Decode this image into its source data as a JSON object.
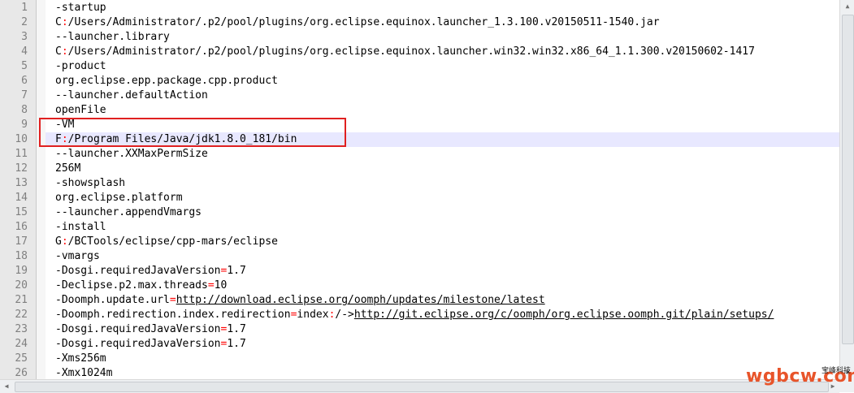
{
  "editor": {
    "highlighted_line": 10,
    "lines": [
      {
        "n": "1",
        "parts": [
          {
            "t": "-startup"
          }
        ]
      },
      {
        "n": "2",
        "parts": [
          {
            "t": "C"
          },
          {
            "t": ":",
            "op": true
          },
          {
            "t": "/Users/Administrator/.p2/pool/plugins/org.eclipse.equinox.launcher_1.3.100.v20150511-1540.jar"
          }
        ]
      },
      {
        "n": "3",
        "parts": [
          {
            "t": "--launcher.library"
          }
        ]
      },
      {
        "n": "4",
        "parts": [
          {
            "t": "C"
          },
          {
            "t": ":",
            "op": true
          },
          {
            "t": "/Users/Administrator/.p2/pool/plugins/org.eclipse.equinox.launcher.win32.win32.x86_64_1.1.300.v20150602-1417"
          }
        ]
      },
      {
        "n": "5",
        "parts": [
          {
            "t": "-product"
          }
        ]
      },
      {
        "n": "6",
        "parts": [
          {
            "t": "org.eclipse.epp.package.cpp.product"
          }
        ]
      },
      {
        "n": "7",
        "parts": [
          {
            "t": "--launcher.defaultAction"
          }
        ]
      },
      {
        "n": "8",
        "parts": [
          {
            "t": "openFile"
          }
        ]
      },
      {
        "n": "9",
        "parts": [
          {
            "t": "-VM"
          }
        ]
      },
      {
        "n": "10",
        "parts": [
          {
            "t": "F"
          },
          {
            "t": ":",
            "op": true
          },
          {
            "t": "/Program Files/Java/jdk1.8.0_181/bin"
          }
        ]
      },
      {
        "n": "11",
        "parts": [
          {
            "t": "--launcher.XXMaxPermSize"
          }
        ]
      },
      {
        "n": "12",
        "parts": [
          {
            "t": "256M"
          }
        ]
      },
      {
        "n": "13",
        "parts": [
          {
            "t": "-showsplash"
          }
        ]
      },
      {
        "n": "14",
        "parts": [
          {
            "t": "org.eclipse.platform"
          }
        ]
      },
      {
        "n": "15",
        "parts": [
          {
            "t": "--launcher.appendVmargs"
          }
        ]
      },
      {
        "n": "16",
        "parts": [
          {
            "t": "-install"
          }
        ]
      },
      {
        "n": "17",
        "parts": [
          {
            "t": "G"
          },
          {
            "t": ":",
            "op": true
          },
          {
            "t": "/BCTools/eclipse/cpp-mars/eclipse"
          }
        ]
      },
      {
        "n": "18",
        "parts": [
          {
            "t": "-vmargs"
          }
        ]
      },
      {
        "n": "19",
        "parts": [
          {
            "t": "-Dosgi.requiredJavaVersion"
          },
          {
            "t": "=",
            "op": true
          },
          {
            "t": "1.7"
          }
        ]
      },
      {
        "n": "20",
        "parts": [
          {
            "t": "-Declipse.p2.max.threads"
          },
          {
            "t": "=",
            "op": true
          },
          {
            "t": "10"
          }
        ]
      },
      {
        "n": "21",
        "parts": [
          {
            "t": "-Doomph.update.url"
          },
          {
            "t": "=",
            "op": true
          },
          {
            "t": "http://download.eclipse.org/oomph/updates/milestone/latest",
            "link": true
          }
        ]
      },
      {
        "n": "22",
        "parts": [
          {
            "t": "-Doomph.redirection.index.redirection"
          },
          {
            "t": "=",
            "op": true
          },
          {
            "t": "index"
          },
          {
            "t": ":",
            "op": true
          },
          {
            "t": "/->"
          },
          {
            "t": "http://git.eclipse.org/c/oomph/org.eclipse.oomph.git/plain/setups/",
            "link": true
          }
        ]
      },
      {
        "n": "23",
        "parts": [
          {
            "t": "-Dosgi.requiredJavaVersion"
          },
          {
            "t": "=",
            "op": true
          },
          {
            "t": "1.7"
          }
        ]
      },
      {
        "n": "24",
        "parts": [
          {
            "t": "-Dosgi.requiredJavaVersion"
          },
          {
            "t": "=",
            "op": true
          },
          {
            "t": "1.7"
          }
        ]
      },
      {
        "n": "25",
        "parts": [
          {
            "t": "-Xms256m"
          }
        ]
      },
      {
        "n": "26",
        "parts": [
          {
            "t": "-Xmx1024m"
          }
        ]
      }
    ]
  },
  "watermark": {
    "text": "wgbcw.com",
    "cn_text": "宝峰科技"
  },
  "colors": {
    "operator": "#ff0000",
    "highlight": "#e8e8ff",
    "annotation_box": "#e02020",
    "watermark": "#e8542a"
  }
}
